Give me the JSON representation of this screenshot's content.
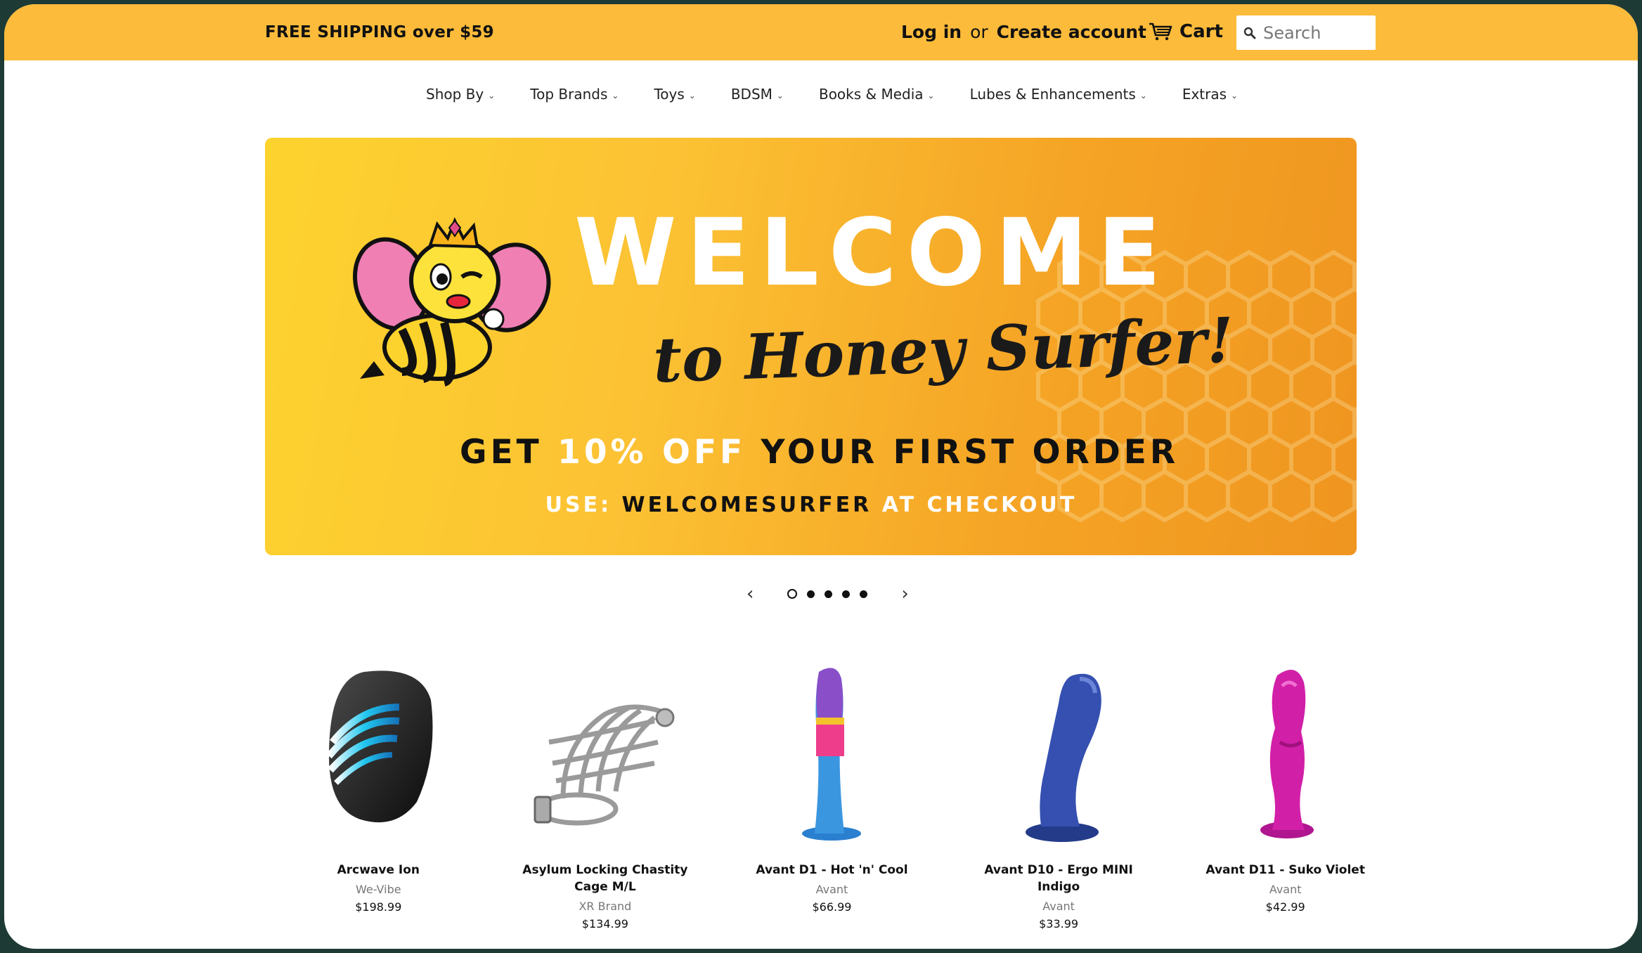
{
  "topbar": {
    "shipping": "FREE SHIPPING over $59",
    "login": "Log in",
    "or": "or",
    "create_account": "Create account",
    "cart": "Cart",
    "search_placeholder": "Search"
  },
  "nav": {
    "items": [
      {
        "label": "Shop By"
      },
      {
        "label": "Top Brands"
      },
      {
        "label": "Toys"
      },
      {
        "label": "BDSM"
      },
      {
        "label": "Books & Media"
      },
      {
        "label": "Lubes & Enhancements"
      },
      {
        "label": "Extras"
      }
    ]
  },
  "banner": {
    "headline": "WELCOME",
    "subheadline": "to Honey Surfer!",
    "offer_prefix": "GET",
    "offer_highlight": "10% OFF",
    "offer_suffix": "YOUR FIRST ORDER",
    "code_prefix": "USE:",
    "code": "WELCOMESURFER",
    "code_suffix": "AT CHECKOUT"
  },
  "slider": {
    "slide_count": 5,
    "active_index": 0
  },
  "colors": {
    "topbar": "#fcbb3a",
    "banner_start": "#fdd32e",
    "banner_end": "#ef9520",
    "frame": "#1e3a34"
  },
  "products": [
    {
      "name": "Arcwave Ion",
      "brand": "We-Vibe",
      "price": "$198.99",
      "icon": "stroker-black"
    },
    {
      "name": "Asylum Locking Chastity Cage M/L",
      "brand": "XR Brand",
      "price": "$134.99",
      "icon": "chastity-cage-metal"
    },
    {
      "name": "Avant D1 - Hot 'n' Cool",
      "brand": "Avant",
      "price": "$66.99",
      "icon": "dildo-multicolor"
    },
    {
      "name": "Avant D10 - Ergo MINI Indigo",
      "brand": "Avant",
      "price": "$33.99",
      "icon": "dildo-indigo"
    },
    {
      "name": "Avant D11 - Suko Violet",
      "brand": "Avant",
      "price": "$42.99",
      "icon": "dildo-violet"
    }
  ]
}
